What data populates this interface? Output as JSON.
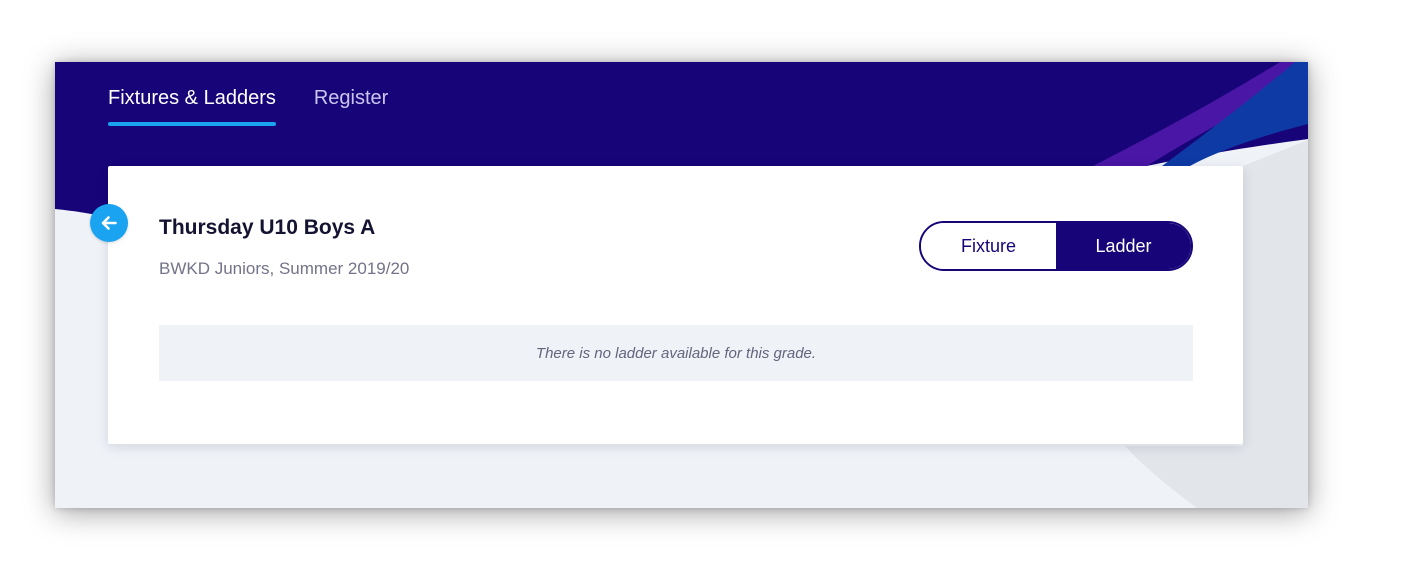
{
  "nav": {
    "tabs": [
      {
        "label": "Fixtures & Ladders",
        "active": true
      },
      {
        "label": "Register",
        "active": false
      }
    ]
  },
  "card": {
    "title": "Thursday U10 Boys A",
    "subtitle": "BWKD Juniors, Summer 2019/20",
    "toggle": {
      "fixture_label": "Fixture",
      "ladder_label": "Ladder",
      "selected": "Ladder"
    },
    "empty_message": "There is no ladder available for this grade."
  },
  "icons": {
    "back": "arrow-left-icon"
  },
  "colors": {
    "header_navy": "#170479",
    "accent_blue": "#1aa3f0",
    "page_background": "#eff2f7",
    "swoosh_purple": "#4a16a5",
    "swoosh_blue": "#0e3aa5"
  }
}
